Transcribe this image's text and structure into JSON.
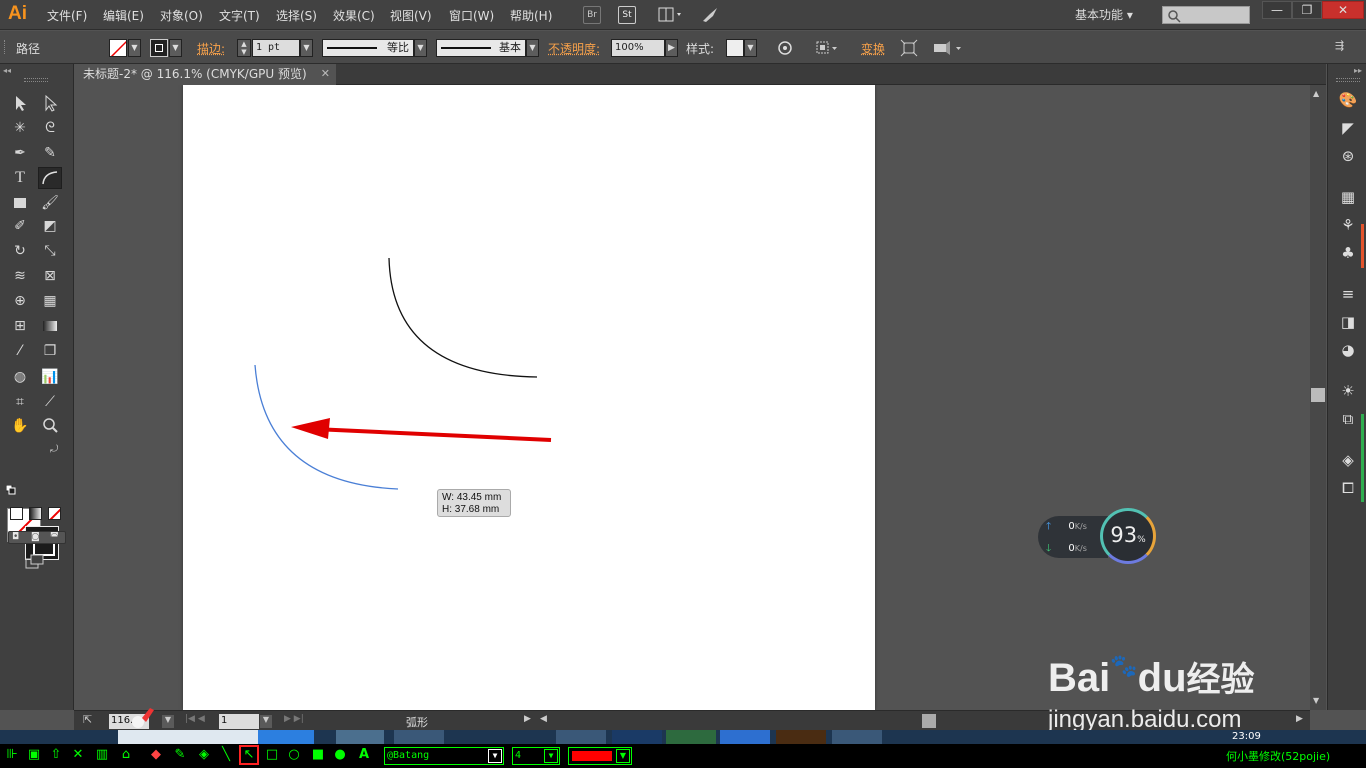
{
  "app": {
    "logo": "Ai"
  },
  "menu": [
    "文件(F)",
    "编辑(E)",
    "对象(O)",
    "文字(T)",
    "选择(S)",
    "效果(C)",
    "视图(V)",
    "窗口(W)",
    "帮助(H)"
  ],
  "menu_buttons": {
    "bridge": "Br",
    "stock": "St"
  },
  "workspace": {
    "label": "基本功能"
  },
  "window_buttons": {
    "minimize": "—",
    "restore": "❐",
    "close": "✕"
  },
  "control": {
    "object_type": "路径",
    "stroke_label": "描边:",
    "stroke_weight": "1 pt",
    "profile_label": "等比",
    "brush_label": "基本",
    "opacity_label": "不透明度:",
    "opacity_value": "100%",
    "style_label": "样式:",
    "transform_label": "变换"
  },
  "document": {
    "tab_title": "未标题-2* @ 116.1% (CMYK/GPU 预览)",
    "close": "✕"
  },
  "tooltip": {
    "width": "W: 43.45 mm",
    "height": "H: 37.68 mm"
  },
  "status": {
    "zoom": "116.",
    "artboard": "1",
    "tool_name": "弧形"
  },
  "speed": {
    "up": "0",
    "down": "0",
    "unit": "K/s",
    "percent": "93",
    "percent_sign": "%"
  },
  "watermark": {
    "brand": "Bai",
    "brand2": "du",
    "suffix": "经验",
    "url": "jingyan.baidu.com"
  },
  "greenbar": {
    "font": "@Batang",
    "size": "4",
    "credit": "何小墨修改(52pojie)"
  },
  "clock": "23:09",
  "colors": {
    "accent_orange": "#f7931e",
    "red_arrow": "#e00000",
    "blue_arc": "#4a7fd6",
    "green": "#00ff00"
  }
}
